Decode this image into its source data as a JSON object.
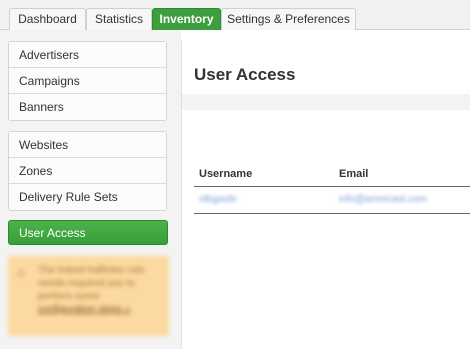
{
  "tabs": [
    {
      "label": "Dashboard",
      "active": false
    },
    {
      "label": "Statistics",
      "active": false
    },
    {
      "label": "Inventory",
      "active": true
    },
    {
      "label": "Settings & Preferences",
      "active": false
    }
  ],
  "sidebar": {
    "group1": [
      "Advertisers",
      "Campaigns",
      "Banners"
    ],
    "group2": [
      "Websites",
      "Zones",
      "Delivery Rule Sets"
    ],
    "active_item": "User Access",
    "notice": {
      "icon": "warning-icon",
      "text": "The linked trafficker role needs required you to perform some",
      "link": "configuration steps »"
    }
  },
  "main": {
    "title": "User Access",
    "columns": [
      "Username",
      "Email"
    ],
    "rows": [
      {
        "username": "olbgasfe",
        "email": "info@amnicast.com"
      }
    ]
  },
  "colors": {
    "accent": "#3c9e3c",
    "notice_bg": "#fcd9a0",
    "link": "#7d9fd6"
  }
}
